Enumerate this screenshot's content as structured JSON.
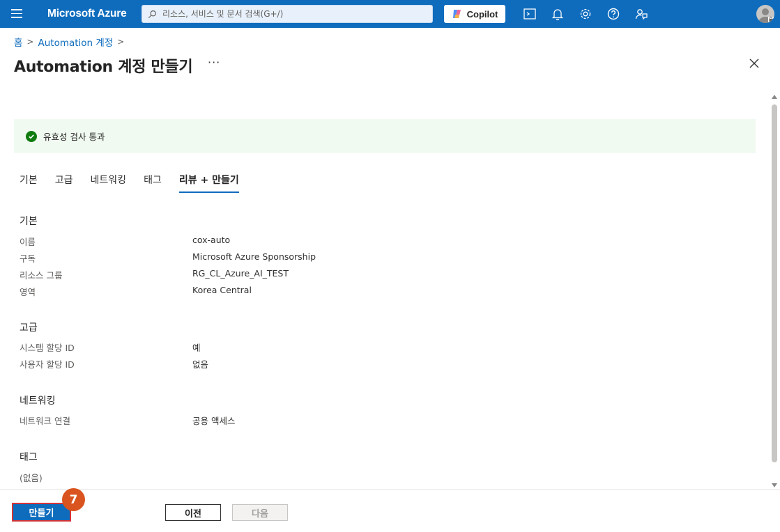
{
  "topbar": {
    "brand": "Microsoft Azure",
    "search_placeholder": "리소스, 서비스 및 문서 검색(G+/)",
    "copilot_label": "Copilot",
    "icons": [
      "cloud-shell-icon",
      "bell-icon",
      "gear-icon",
      "help-icon",
      "feedback-icon"
    ]
  },
  "breadcrumb": {
    "home": "홈",
    "parent": "Automation 계정"
  },
  "page": {
    "title": "Automation 계정 만들기",
    "more": "···"
  },
  "validation": {
    "message": "유효성 검사 통과",
    "color": "#107c10"
  },
  "tabs": [
    {
      "label": "기본"
    },
    {
      "label": "고급"
    },
    {
      "label": "네트워킹"
    },
    {
      "label": "태그"
    },
    {
      "label": "리뷰 + 만들기",
      "active": true
    }
  ],
  "sections": {
    "basic": {
      "title": "기본",
      "rows": [
        {
          "label": "이름",
          "value": "cox-auto"
        },
        {
          "label": "구독",
          "value": "Microsoft Azure Sponsorship"
        },
        {
          "label": "리소스 그룹",
          "value": "RG_CL_Azure_AI_TEST"
        },
        {
          "label": "영역",
          "value": "Korea Central"
        }
      ]
    },
    "advanced": {
      "title": "고급",
      "rows": [
        {
          "label": "시스템 할당 ID",
          "value": "예"
        },
        {
          "label": "사용자 할당 ID",
          "value": "없음"
        }
      ]
    },
    "networking": {
      "title": "네트워킹",
      "rows": [
        {
          "label": "네트워크 연결",
          "value": "공용 액세스"
        }
      ]
    },
    "tags": {
      "title": "태그",
      "empty": "(없음)"
    }
  },
  "footer": {
    "create_label": "만들기",
    "prev_label": "이전",
    "next_label": "다음",
    "step_badge": "7"
  },
  "colors": {
    "accent": "#0f6cbd",
    "badge": "#d9541e",
    "highlight": "#d13438"
  }
}
